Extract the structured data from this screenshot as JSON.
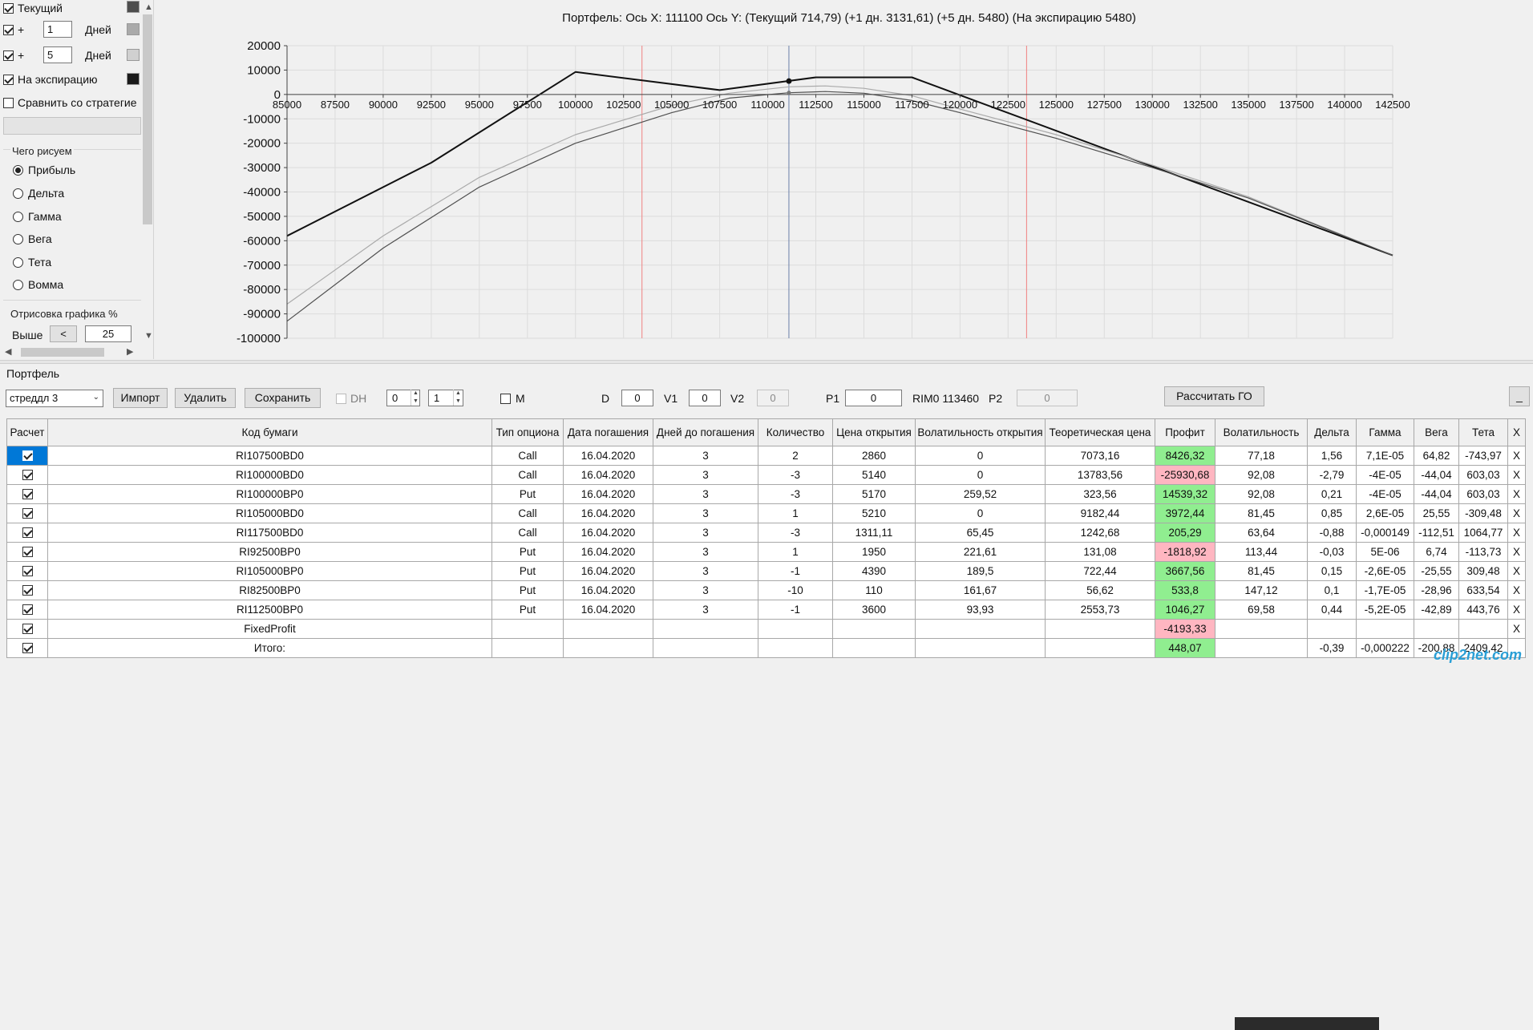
{
  "left_panel": {
    "curves": [
      {
        "label": "Текущий",
        "checked": true,
        "color": "#4d4d4d"
      },
      {
        "label": "+",
        "days_value": "1",
        "days_label": "Дней",
        "checked": true,
        "color": "#aaaaaa"
      },
      {
        "label": "+",
        "days_value": "5",
        "days_label": "Дней",
        "checked": true,
        "color": "#d0d0d0"
      },
      {
        "label": "На экспирацию",
        "checked": true,
        "color": "#1a1a1a"
      },
      {
        "label": "Сравнить со стратегие",
        "checked": false
      }
    ],
    "draw_group_title": "Чего рисуем",
    "draw_options": [
      {
        "label": "Прибыль",
        "checked": true
      },
      {
        "label": "Дельта",
        "checked": false
      },
      {
        "label": "Гамма",
        "checked": false
      },
      {
        "label": "Вега",
        "checked": false
      },
      {
        "label": "Тета",
        "checked": false
      },
      {
        "label": "Вомма",
        "checked": false
      }
    ],
    "render_group_title": "Отрисовка графика %",
    "above_label": "Выше",
    "above_btn": "<",
    "above_value": "25"
  },
  "chart_data": {
    "type": "line",
    "title": "Портфель: Ось X: 111100 Ось Y:  (Текущий 714,79)  (+1 дн. 3131,61)  (+5 дн. 5480)  (На экспирацию 5480)",
    "x_ticks": [
      85000,
      87500,
      90000,
      92500,
      95000,
      97500,
      100000,
      102500,
      105000,
      107500,
      110000,
      112500,
      115000,
      117500,
      120000,
      122500,
      125000,
      127500,
      130000,
      132500,
      135000,
      137500,
      140000,
      142500
    ],
    "y_ticks": [
      20000,
      10000,
      0,
      -10000,
      -20000,
      -30000,
      -40000,
      -50000,
      -60000,
      -70000,
      -80000,
      -90000,
      -100000
    ],
    "xlim": [
      85000,
      142500
    ],
    "ylim": [
      -100000,
      20000
    ],
    "grid": true,
    "vertical_lines": [
      {
        "x": 103460,
        "color": "#f08080"
      },
      {
        "x": 111100,
        "color": "#6a7fa8"
      },
      {
        "x": 123460,
        "color": "#f08080"
      }
    ],
    "markers": [
      {
        "x": 111100,
        "y": 5480
      },
      {
        "x": 111100,
        "y": 714.79
      }
    ],
    "series": [
      {
        "color": "#111111",
        "width": 2,
        "points": [
          [
            85000,
            -58000
          ],
          [
            92500,
            -28000
          ],
          [
            100000,
            9200
          ],
          [
            107500,
            1800
          ],
          [
            112500,
            7000
          ],
          [
            117500,
            7000
          ],
          [
            142500,
            -66000
          ]
        ]
      },
      {
        "color": "#aaaaaa",
        "width": 1.2,
        "points": [
          [
            85000,
            -86000
          ],
          [
            90000,
            -58000
          ],
          [
            95000,
            -34000
          ],
          [
            100000,
            -16500
          ],
          [
            105000,
            -4500
          ],
          [
            108000,
            500
          ],
          [
            111100,
            3131.61
          ],
          [
            113000,
            3500
          ],
          [
            115000,
            2500
          ],
          [
            117500,
            -500
          ],
          [
            120000,
            -6000
          ],
          [
            125000,
            -16500
          ],
          [
            130000,
            -29000
          ],
          [
            135000,
            -42000
          ],
          [
            142500,
            -66000
          ]
        ]
      },
      {
        "color": "#505050",
        "width": 1.2,
        "points": [
          [
            85000,
            -93000
          ],
          [
            90000,
            -63000
          ],
          [
            95000,
            -38000
          ],
          [
            100000,
            -20000
          ],
          [
            105000,
            -7500
          ],
          [
            108000,
            -1500
          ],
          [
            111100,
            714.79
          ],
          [
            113000,
            1200
          ],
          [
            115000,
            500
          ],
          [
            117500,
            -2500
          ],
          [
            120000,
            -7500
          ],
          [
            125000,
            -18000
          ],
          [
            130000,
            -30000
          ],
          [
            135000,
            -42500
          ],
          [
            142500,
            -66000
          ]
        ]
      }
    ]
  },
  "portfolio": {
    "title": "Портфель",
    "strategy": "стреддл 3",
    "buttons": {
      "import": "Импорт",
      "delete": "Удалить",
      "save": "Сохранить",
      "calc_go": "Рассчитать ГО",
      "minimize": "_"
    },
    "dh_label": "DH",
    "spin1": "0",
    "spin2": "1",
    "m_label": "M",
    "d_label": "D",
    "d_value": "0",
    "v1_label": "V1",
    "v1_value": "0",
    "v2_label": "V2",
    "v2_value": "0",
    "p1_label": "P1",
    "p1_value": "0",
    "underlying": "RIM0 113460",
    "p2_label": "P2",
    "p2_value": "0"
  },
  "grid": {
    "columns": [
      "Расчет",
      "Код бумаги",
      "Тип опциона",
      "Дата погашения",
      "Дней до погашения",
      "Количество",
      "Цена открытия",
      "Волатильность открытия",
      "Теоретическая цена",
      "Профит",
      "Волатильность",
      "Дельта",
      "Гамма",
      "Вега",
      "Тета",
      "X"
    ],
    "rows": [
      {
        "code": "RI107500BD0",
        "type": "Call",
        "date": "16.04.2020",
        "days": "3",
        "qty": "2",
        "price": "2860",
        "vol_open": "0",
        "theor": "7073,16",
        "profit": "8426,32",
        "profit_sign": "pos",
        "vol": "77,18",
        "delta": "1,56",
        "gamma": "7,1E-05",
        "vega": "64,82",
        "theta": "-743,97",
        "x": "X",
        "selected": true
      },
      {
        "code": "RI100000BD0",
        "type": "Call",
        "date": "16.04.2020",
        "days": "3",
        "qty": "-3",
        "price": "5140",
        "vol_open": "0",
        "theor": "13783,56",
        "profit": "-25930,68",
        "profit_sign": "neg",
        "vol": "92,08",
        "delta": "-2,79",
        "gamma": "-4E-05",
        "vega": "-44,04",
        "theta": "603,03",
        "x": "X"
      },
      {
        "code": "RI100000BP0",
        "type": "Put",
        "date": "16.04.2020",
        "days": "3",
        "qty": "-3",
        "price": "5170",
        "vol_open": "259,52",
        "theor": "323,56",
        "profit": "14539,32",
        "profit_sign": "pos",
        "vol": "92,08",
        "delta": "0,21",
        "gamma": "-4E-05",
        "vega": "-44,04",
        "theta": "603,03",
        "x": "X"
      },
      {
        "code": "RI105000BD0",
        "type": "Call",
        "date": "16.04.2020",
        "days": "3",
        "qty": "1",
        "price": "5210",
        "vol_open": "0",
        "theor": "9182,44",
        "profit": "3972,44",
        "profit_sign": "pos",
        "vol": "81,45",
        "delta": "0,85",
        "gamma": "2,6E-05",
        "vega": "25,55",
        "theta": "-309,48",
        "x": "X"
      },
      {
        "code": "RI117500BD0",
        "type": "Call",
        "date": "16.04.2020",
        "days": "3",
        "qty": "-3",
        "price": "1311,11",
        "vol_open": "65,45",
        "theor": "1242,68",
        "profit": "205,29",
        "profit_sign": "pos",
        "vol": "63,64",
        "delta": "-0,88",
        "gamma": "-0,000149",
        "vega": "-112,51",
        "theta": "1064,77",
        "x": "X"
      },
      {
        "code": "RI92500BP0",
        "type": "Put",
        "date": "16.04.2020",
        "days": "3",
        "qty": "1",
        "price": "1950",
        "vol_open": "221,61",
        "theor": "131,08",
        "profit": "-1818,92",
        "profit_sign": "neg",
        "vol": "113,44",
        "delta": "-0,03",
        "gamma": "5E-06",
        "vega": "6,74",
        "theta": "-113,73",
        "x": "X"
      },
      {
        "code": "RI105000BP0",
        "type": "Put",
        "date": "16.04.2020",
        "days": "3",
        "qty": "-1",
        "price": "4390",
        "vol_open": "189,5",
        "theor": "722,44",
        "profit": "3667,56",
        "profit_sign": "pos",
        "vol": "81,45",
        "delta": "0,15",
        "gamma": "-2,6E-05",
        "vega": "-25,55",
        "theta": "309,48",
        "x": "X"
      },
      {
        "code": "RI82500BP0",
        "type": "Put",
        "date": "16.04.2020",
        "days": "3",
        "qty": "-10",
        "price": "110",
        "vol_open": "161,67",
        "theor": "56,62",
        "profit": "533,8",
        "profit_sign": "pos",
        "vol": "147,12",
        "delta": "0,1",
        "gamma": "-1,7E-05",
        "vega": "-28,96",
        "theta": "633,54",
        "x": "X"
      },
      {
        "code": "RI112500BP0",
        "type": "Put",
        "date": "16.04.2020",
        "days": "3",
        "qty": "-1",
        "price": "3600",
        "vol_open": "93,93",
        "theor": "2553,73",
        "profit": "1046,27",
        "profit_sign": "pos",
        "vol": "69,58",
        "delta": "0,44",
        "gamma": "-5,2E-05",
        "vega": "-42,89",
        "theta": "443,76",
        "x": "X"
      },
      {
        "code": "FixedProfit",
        "type": "",
        "date": "",
        "days": "",
        "qty": "",
        "price": "",
        "vol_open": "",
        "theor": "",
        "profit": "-4193,33",
        "profit_sign": "neg",
        "vol": "",
        "delta": "",
        "gamma": "",
        "vega": "",
        "theta": "",
        "x": "X"
      },
      {
        "code": "Итого:",
        "type": "",
        "date": "",
        "days": "",
        "qty": "",
        "price": "",
        "vol_open": "",
        "theor": "",
        "profit": "448,07",
        "profit_sign": "pos",
        "vol": "",
        "delta": "-0,39",
        "gamma": "-0,000222",
        "vega": "-200,88",
        "theta": "2409,42",
        "x": ""
      }
    ]
  },
  "watermark": "clip2net.com"
}
